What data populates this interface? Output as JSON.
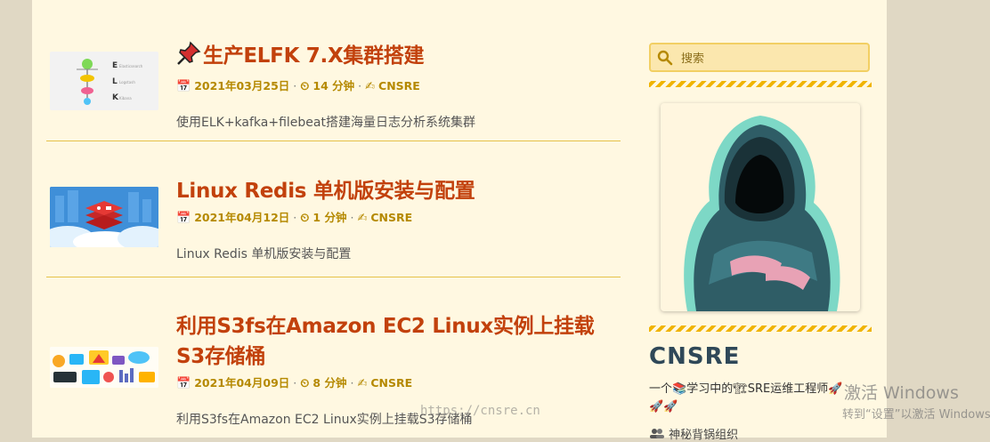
{
  "posts": [
    {
      "pin_icon": "pushpin-icon",
      "title": "生产ELFK 7.X集群搭建",
      "date": "2021年03月25日",
      "read_time": "14 分钟",
      "author": "CNSRE",
      "summary": "使用ELK+kafka+filebeat搭建海量日志分析系统集群",
      "thumb_letters": [
        "E",
        "L",
        "K"
      ],
      "thumb_words": [
        "Elasticsearch",
        "Logstash",
        "Kibana"
      ]
    },
    {
      "title": "Linux Redis 单机版安装与配置",
      "date": "2021年04月12日",
      "read_time": "1 分钟",
      "author": "CNSRE",
      "summary": "Linux Redis 单机版安装与配置"
    },
    {
      "title": "利用S3fs在Amazon EC2 Linux实例上挂载S3存储桶",
      "date": "2021年04月09日",
      "read_time": "8 分钟",
      "author": "CNSRE",
      "summary": "利用S3fs在Amazon EC2 Linux实例上挂载S3存储桶"
    }
  ],
  "meta_separator": "·",
  "sidebar": {
    "search_placeholder": "搜索",
    "site_title": "CNSRE",
    "bio_a": "一个",
    "bio_b": "学习中的",
    "bio_c": "SRE运维工程师",
    "bio_rockets": "🚀🚀",
    "org": "神秘背锅组织"
  },
  "overlay": {
    "watermark": "https://cnsre.cn",
    "activate_title": "激活 Windows",
    "activate_hint": "转到“设置”以激活 Windows"
  },
  "colors": {
    "accent": "#c2410c",
    "meta": "#b58900",
    "page_bg": "#fff8e1",
    "outer_bg": "#e0d8c4",
    "divider": "#e5c24a",
    "stripe": "#f0b400"
  }
}
